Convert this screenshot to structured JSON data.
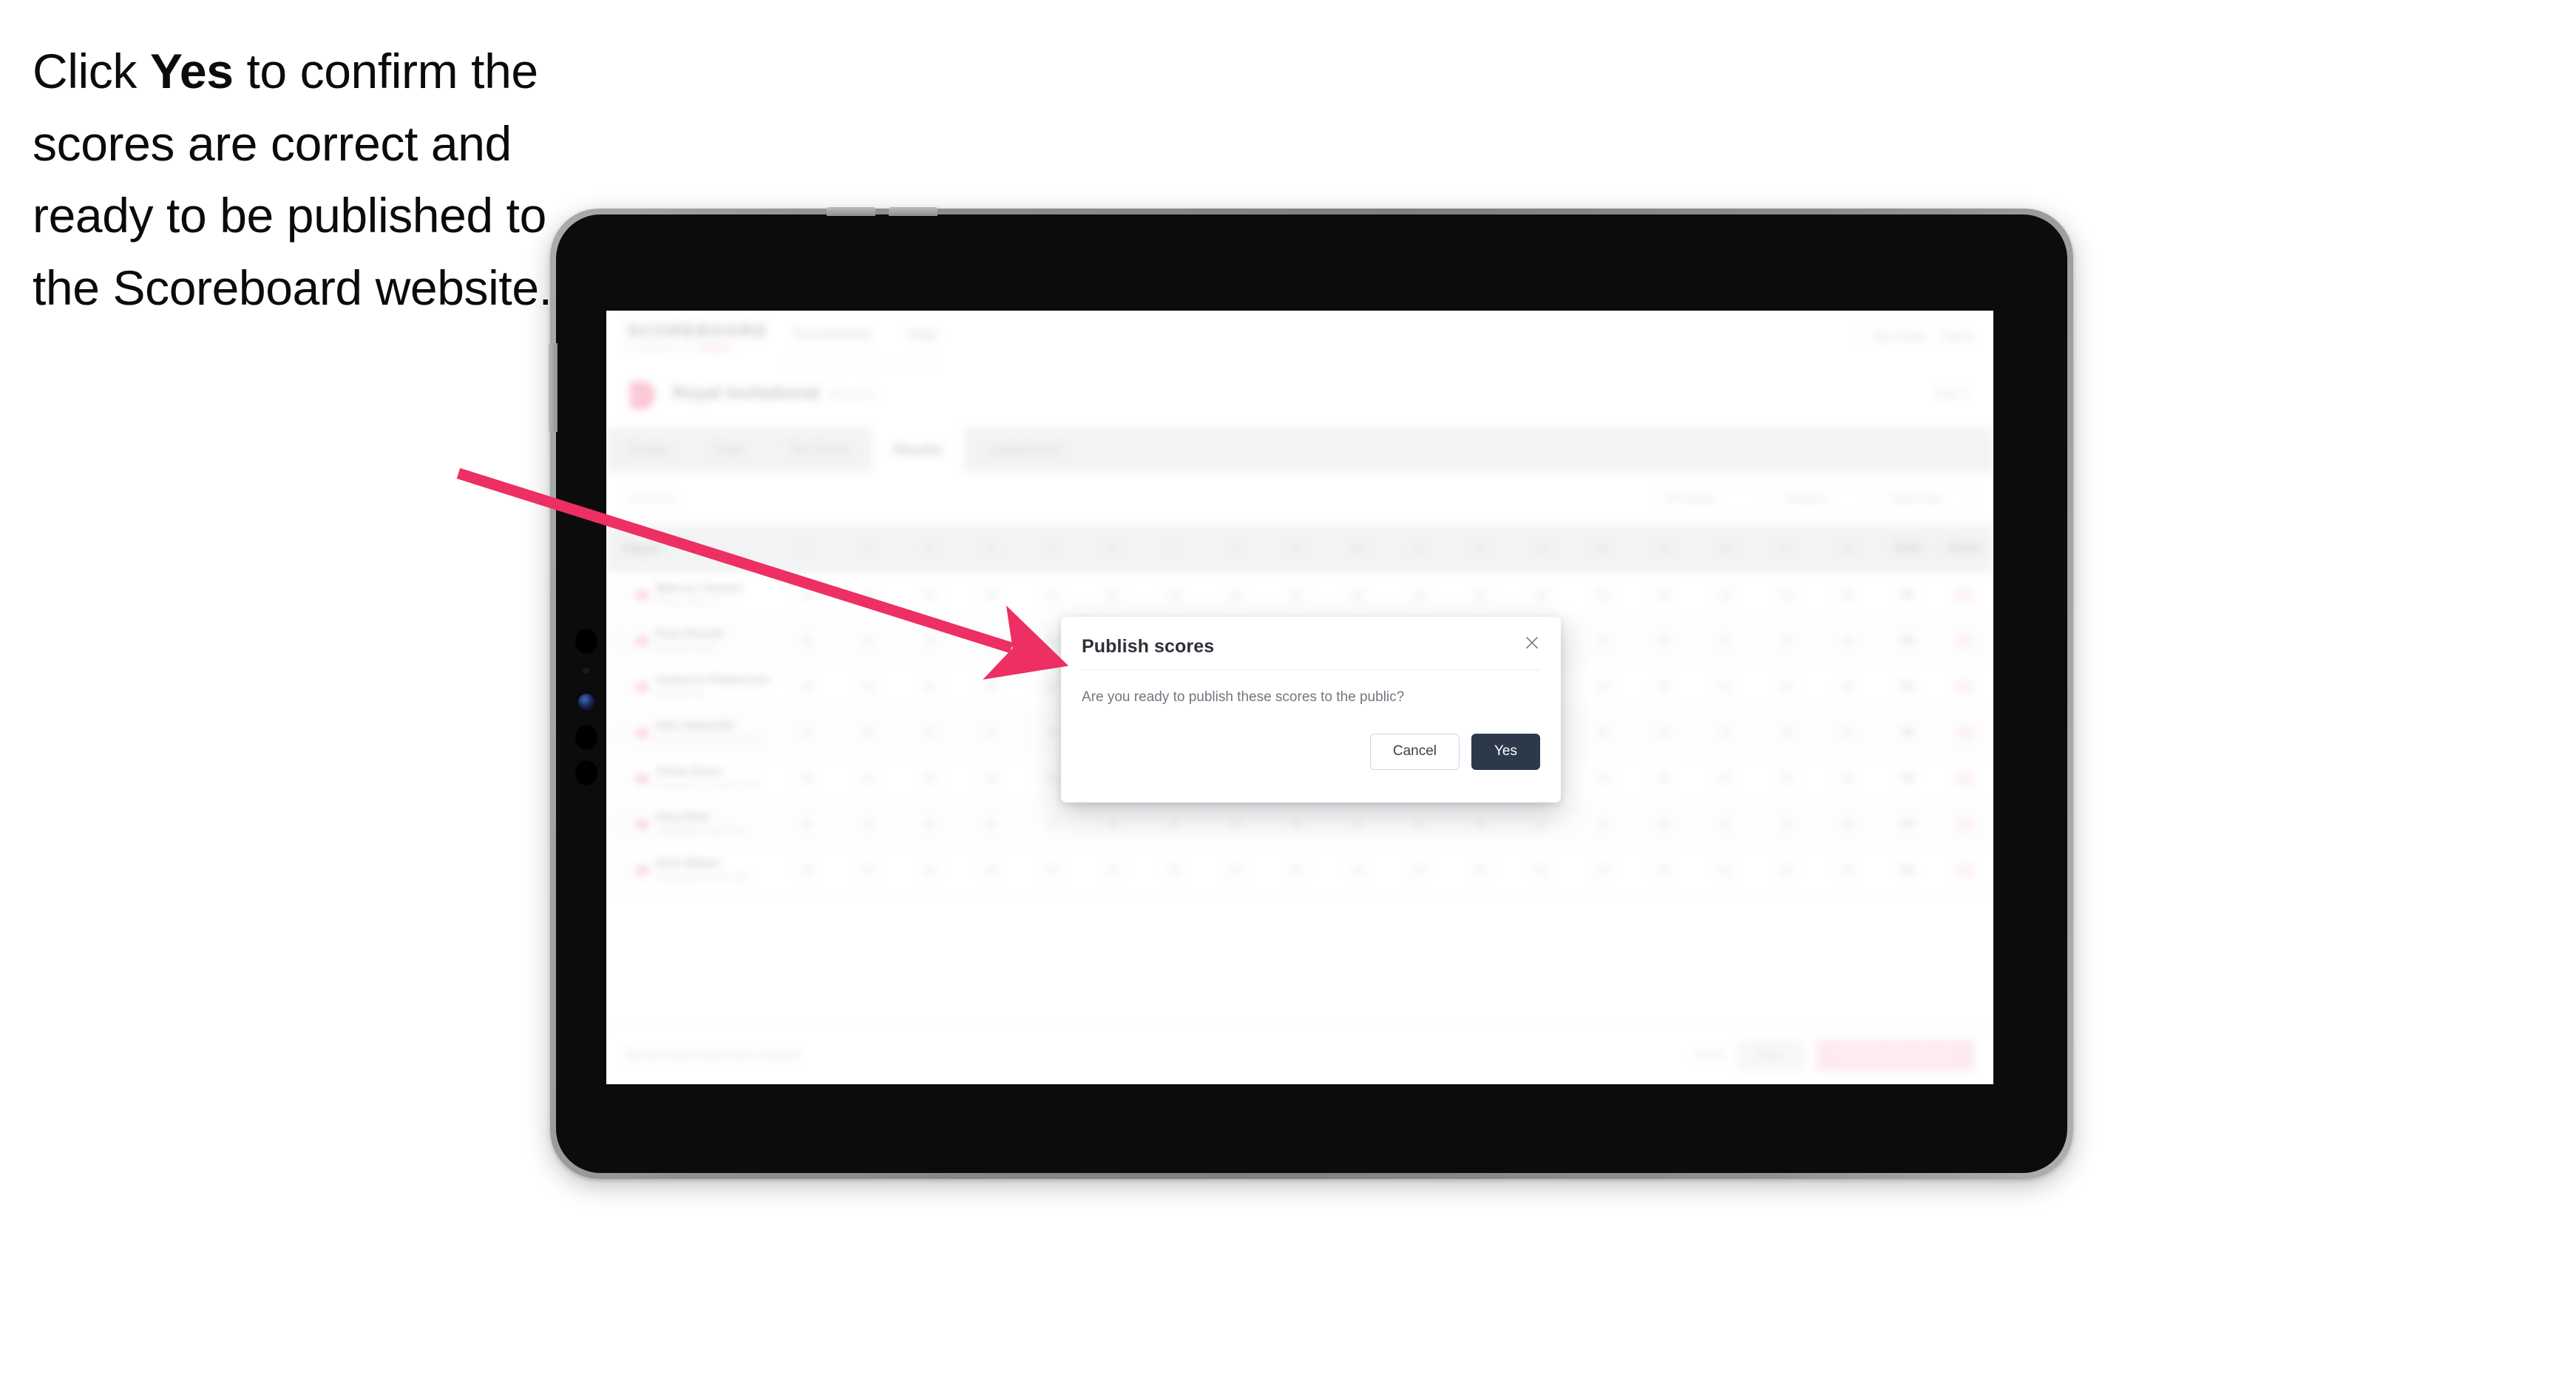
{
  "caption": {
    "before": "Click ",
    "emphasis": "Yes",
    "after": " to confirm the scores are correct and ready to be published to the Scoreboard website."
  },
  "annotation": {
    "arrow_color": "#ed2f63",
    "arrow_name": "pointer-arrow"
  },
  "device": {
    "type": "tablet",
    "frame_color": "#8f9193",
    "body_color": "#0c0c0d",
    "screen_color": "#ffffff"
  },
  "app": {
    "header": {
      "brand": "SCOREBOARD",
      "brand_sub_left": "POWERED BY",
      "brand_sub_accent": "GOLF",
      "nav": [
        "Tournaments",
        "Help"
      ],
      "right": [
        "My Clubs",
        "Menu"
      ]
    },
    "tournament": {
      "name": "Royal Invitational",
      "tag": "Round 2",
      "right": "Day 2"
    },
    "tabs": [
      {
        "label": "Details",
        "active": false
      },
      {
        "label": "Draw",
        "active": false
      },
      {
        "label": "Tee Times",
        "active": false
      },
      {
        "label": "Results",
        "active": true
      },
      {
        "label": "Leaderboard",
        "active": false
      }
    ],
    "filters": {
      "left_label": "Filter",
      "pills": [
        "All rounds",
        "Round 2",
        "Team only"
      ]
    },
    "table": {
      "columns": [
        "Player",
        "1",
        "2",
        "3",
        "4",
        "5",
        "6",
        "7",
        "8",
        "9",
        "10",
        "11",
        "12",
        "13",
        "14",
        "15",
        "16",
        "17",
        "18",
        "OUT",
        "IN",
        "Total",
        "Score"
      ],
      "rows": [
        {
          "name": "Marcus Travers",
          "club": "Royal Oaks GC",
          "holes": [
            "4",
            "5",
            "3",
            "4",
            "4",
            "5",
            "4",
            "3",
            "4",
            "5",
            "4",
            "4",
            "3",
            "5",
            "4",
            "4",
            "3",
            "5"
          ],
          "out": "36",
          "in": "37",
          "total": "73",
          "score": "+1"
        },
        {
          "name": "Finn Parnell",
          "club": "Bayside Links",
          "holes": [
            "5",
            "4",
            "3",
            "4",
            "5",
            "4",
            "4",
            "4",
            "3",
            "4",
            "5",
            "4",
            "4",
            "4",
            "3",
            "5",
            "4",
            "4"
          ],
          "out": "36",
          "in": "37",
          "total": "73",
          "score": "+1"
        },
        {
          "name": "Cameron Robertson",
          "club": "Westhill GC",
          "holes": [
            "4",
            "4",
            "4",
            "3",
            "5",
            "4",
            "5",
            "3",
            "4",
            "4",
            "4",
            "5",
            "3",
            "4",
            "4",
            "4",
            "5",
            "4"
          ],
          "out": "36",
          "in": "37",
          "total": "73",
          "score": "+1"
        },
        {
          "name": "Alex Naismith",
          "club": "Greenacre Country Club",
          "holes": [
            "4",
            "5",
            "4",
            "4",
            "3",
            "5",
            "4",
            "4",
            "4",
            "3",
            "5",
            "4",
            "4",
            "5",
            "3",
            "4",
            "4",
            "5"
          ],
          "out": "37",
          "in": "37",
          "total": "74",
          "score": "+2"
        },
        {
          "name": "Chloe Dunn",
          "club": "Greenacre Country Club",
          "holes": [
            "5",
            "4",
            "4",
            "4",
            "4",
            "3",
            "5",
            "4",
            "4",
            "4",
            "4",
            "5",
            "3",
            "4",
            "5",
            "4",
            "3",
            "5"
          ],
          "out": "37",
          "in": "37",
          "total": "74",
          "score": "+2"
        },
        {
          "name": "Sara Britt",
          "club": "Northlands Golf Club",
          "holes": [
            "4",
            "4",
            "5",
            "3",
            "4",
            "4",
            "4",
            "5",
            "4",
            "5",
            "3",
            "4",
            "4",
            "4",
            "4",
            "5",
            "4",
            "3"
          ],
          "out": "37",
          "in": "36",
          "total": "73",
          "score": "+1"
        },
        {
          "name": "Nick Weber",
          "club": "Southdown Golf Links",
          "holes": [
            "4",
            "5",
            "4",
            "4",
            "4",
            "4",
            "3",
            "5",
            "4",
            "4",
            "4",
            "4",
            "5",
            "3",
            "4",
            "4",
            "5",
            "4"
          ],
          "out": "37",
          "in": "37",
          "total": "74",
          "score": "+2"
        }
      ]
    },
    "action_bar": {
      "note": "Not all scores have been entered",
      "link": "Reset",
      "secondary": "Save",
      "primary": "Publish to Scoreboard"
    }
  },
  "modal": {
    "title": "Publish scores",
    "body": "Are you ready to publish these scores to the public?",
    "cancel_label": "Cancel",
    "confirm_label": "Yes",
    "close_icon": "close-icon",
    "confirm_color": "#2c394b"
  }
}
